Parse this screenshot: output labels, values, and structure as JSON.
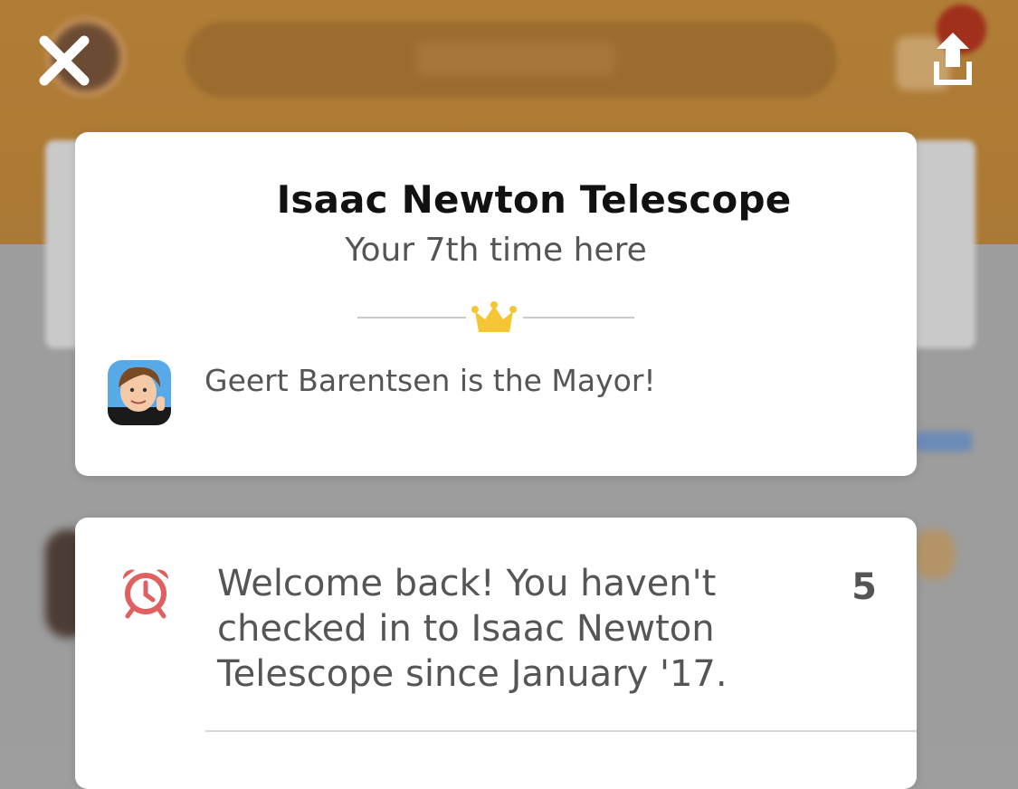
{
  "venue": {
    "name": "Isaac Newton Telescope",
    "visit_text": "Your 7th time here"
  },
  "mayor": {
    "text": "Geert Barentsen is the Mayor!"
  },
  "welcome": {
    "text": "Welcome back! You haven't checked in to Isaac Newton Telescope since January '17.",
    "count": "5"
  },
  "background": {
    "search_placeholder": "Search"
  },
  "icons": {
    "close": "close-icon",
    "share": "share-icon",
    "crown": "crown-icon",
    "alarm": "alarm-clock-icon"
  },
  "colors": {
    "header_brown": "#ad7a35",
    "crown_yellow": "#f6c534",
    "alarm_red": "#e06060",
    "text_dark": "#111111",
    "text_gray": "#555555"
  }
}
